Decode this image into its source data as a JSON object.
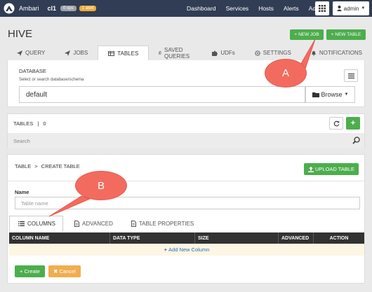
{
  "topbar": {
    "brand": "Ambari",
    "cluster": "cl1",
    "ops_badge": "0 ops",
    "alert_badge": "1 alert",
    "nav": [
      "Dashboard",
      "Services",
      "Hosts",
      "Alerts",
      "Admin"
    ],
    "user": "admin"
  },
  "page": {
    "title": "HIVE",
    "new_job": "NEW JOB",
    "new_table": "NEW TABLE"
  },
  "tabs": [
    {
      "label": "QUERY",
      "icon": "paper-plane-icon"
    },
    {
      "label": "JOBS",
      "icon": "paper-plane-icon"
    },
    {
      "label": "TABLES",
      "icon": "table-icon"
    },
    {
      "label": "SAVED QUERIES",
      "icon": "paperclip-icon"
    },
    {
      "label": "UDFs",
      "icon": "puzzle-icon"
    },
    {
      "label": "SETTINGS",
      "icon": "gear-icon"
    },
    {
      "label": "NOTIFICATIONS",
      "icon": "bell-icon"
    }
  ],
  "database": {
    "label": "DATABASE",
    "hint": "Select or search database/schema",
    "value": "default",
    "browse": "Browse"
  },
  "tables": {
    "label": "TABLES",
    "separator": "|",
    "count": "0",
    "search_placeholder": "Search"
  },
  "create": {
    "crumb_root": "TABLE",
    "crumb_sep": ">",
    "crumb_current": "CREATE TABLE",
    "upload": "UPLOAD TABLE",
    "name_label": "Name",
    "name_placeholder": "Table name",
    "tabs": [
      "COLUMNS",
      "ADVANCED",
      "TABLE PROPERTIES"
    ],
    "columns": [
      "COLUMN NAME",
      "DATA TYPE",
      "SIZE",
      "ADVANCED",
      "ACTION"
    ],
    "add_column": "Add New Column",
    "create_btn": "Create",
    "cancel_btn": "Cancel"
  },
  "callouts": {
    "a": "A",
    "b": "B"
  },
  "colors": {
    "nav_bg": "#303d54",
    "green": "#4cae4c",
    "orange": "#f0ad4e",
    "callout": "#f36b5f",
    "link": "#2a6fb6"
  }
}
